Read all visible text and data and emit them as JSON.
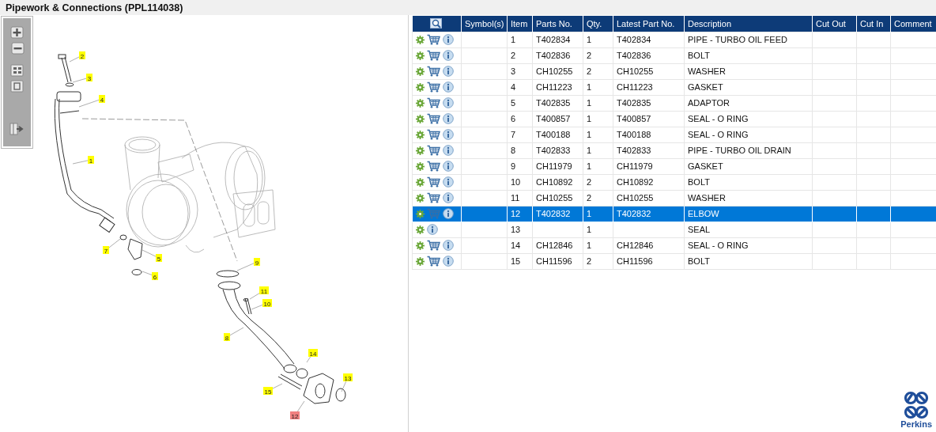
{
  "window": {
    "title": "Pipework & Connections (PPL114038)"
  },
  "diagram": {
    "callouts": [
      {
        "label": "2",
        "selected": false
      },
      {
        "label": "3",
        "selected": false
      },
      {
        "label": "4",
        "selected": false
      },
      {
        "label": "1",
        "selected": false
      },
      {
        "label": "7",
        "selected": false
      },
      {
        "label": "5",
        "selected": false
      },
      {
        "label": "6",
        "selected": false
      },
      {
        "label": "9",
        "selected": false
      },
      {
        "label": "11",
        "selected": false
      },
      {
        "label": "10",
        "selected": false
      },
      {
        "label": "8",
        "selected": false
      },
      {
        "label": "14",
        "selected": false
      },
      {
        "label": "13",
        "selected": false
      },
      {
        "label": "15",
        "selected": false
      },
      {
        "label": "12",
        "selected": true
      }
    ]
  },
  "table": {
    "columns": [
      "Symbol(s)",
      "Item",
      "Parts No.",
      "Qty.",
      "Latest Part No.",
      "Description",
      "Cut Out",
      "Cut In",
      "Comment"
    ],
    "rows": [
      {
        "item": "1",
        "parts_no": "T402834",
        "qty": "1",
        "latest_part_no": "T402834",
        "description": "PIPE - TURBO OIL FEED",
        "cart": true,
        "selected": false
      },
      {
        "item": "2",
        "parts_no": "T402836",
        "qty": "2",
        "latest_part_no": "T402836",
        "description": "BOLT",
        "cart": true,
        "selected": false
      },
      {
        "item": "3",
        "parts_no": "CH10255",
        "qty": "2",
        "latest_part_no": "CH10255",
        "description": "WASHER",
        "cart": true,
        "selected": false
      },
      {
        "item": "4",
        "parts_no": "CH11223",
        "qty": "1",
        "latest_part_no": "CH11223",
        "description": "GASKET",
        "cart": true,
        "selected": false
      },
      {
        "item": "5",
        "parts_no": "T402835",
        "qty": "1",
        "latest_part_no": "T402835",
        "description": "ADAPTOR",
        "cart": true,
        "selected": false
      },
      {
        "item": "6",
        "parts_no": "T400857",
        "qty": "1",
        "latest_part_no": "T400857",
        "description": "SEAL - O RING",
        "cart": true,
        "selected": false
      },
      {
        "item": "7",
        "parts_no": "T400188",
        "qty": "1",
        "latest_part_no": "T400188",
        "description": "SEAL - O RING",
        "cart": true,
        "selected": false
      },
      {
        "item": "8",
        "parts_no": "T402833",
        "qty": "1",
        "latest_part_no": "T402833",
        "description": "PIPE - TURBO OIL DRAIN",
        "cart": true,
        "selected": false
      },
      {
        "item": "9",
        "parts_no": "CH11979",
        "qty": "1",
        "latest_part_no": "CH11979",
        "description": "GASKET",
        "cart": true,
        "selected": false
      },
      {
        "item": "10",
        "parts_no": "CH10892",
        "qty": "2",
        "latest_part_no": "CH10892",
        "description": "BOLT",
        "cart": true,
        "selected": false
      },
      {
        "item": "11",
        "parts_no": "CH10255",
        "qty": "2",
        "latest_part_no": "CH10255",
        "description": "WASHER",
        "cart": true,
        "selected": false
      },
      {
        "item": "12",
        "parts_no": "T402832",
        "qty": "1",
        "latest_part_no": "T402832",
        "description": "ELBOW",
        "cart": true,
        "selected": true
      },
      {
        "item": "13",
        "qty": "1",
        "description": "SEAL",
        "cart": false,
        "selected": false
      },
      {
        "item": "14",
        "parts_no": "CH12846",
        "qty": "1",
        "latest_part_no": "CH12846",
        "description": "SEAL - O RING",
        "cart": true,
        "selected": false
      },
      {
        "item": "15",
        "parts_no": "CH11596",
        "qty": "2",
        "latest_part_no": "CH11596",
        "description": "BOLT",
        "cart": true,
        "selected": false
      }
    ]
  },
  "logo": {
    "text": "Perkins"
  }
}
